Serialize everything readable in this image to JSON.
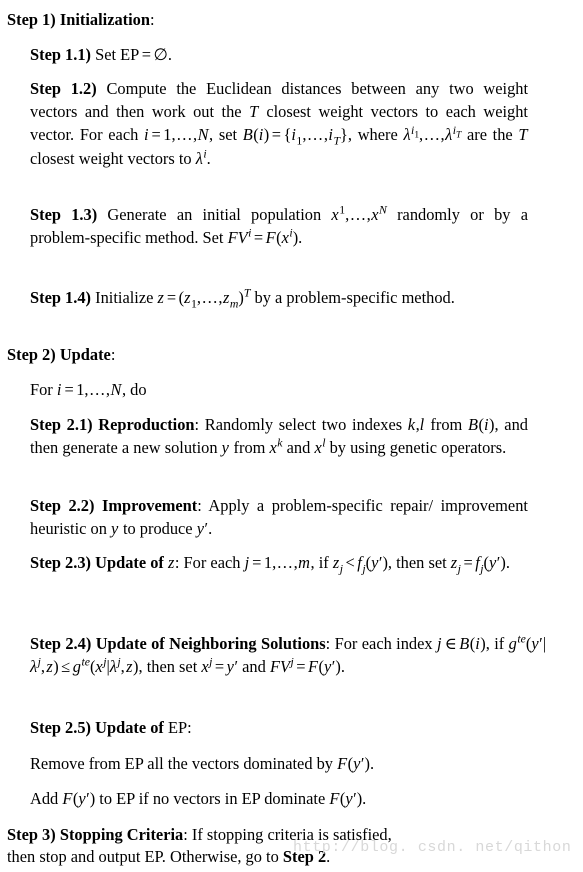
{
  "document": {
    "type": "algorithm-pseudocode",
    "title_implied": "MOEA/D Algorithm Steps",
    "watermark": "http://blog. csdn. net/qithon",
    "watermark_color": "#d8d8d8",
    "text_color": "#000000",
    "background_color": "#ffffff"
  },
  "steps": {
    "step1": {
      "label": "Step 1)",
      "heading": "Initialization",
      "colon": ":"
    },
    "step1_1": {
      "label": "Step 1.1)",
      "text_parts": {
        "a": "Set EP",
        "eq": "=",
        "empty_set": "∅",
        "period": "."
      },
      "plain": "Step 1.1) Set EP = ∅."
    },
    "step1_2": {
      "label": "Step 1.2)",
      "plain": "Step 1.2) Compute the Euclidean distances between any two weight vectors and then work out the T closest weight vectors to each weight vector. For each i = 1,…,N, set B(i) = {i₁,…,i_T}, where λ^{i₁},…,λ^{i_T} are the T closest weight vectors to λ^i.",
      "frag": {
        "f1": "Compute",
        "f2": "the",
        "f3": "Euclidean",
        "f4": "distances",
        "f5": "between",
        "f6": "any",
        "f7": "two weight vectors and then work out the",
        "f8": "closest weight",
        "f9": "vectors to each weight vector. For each",
        "f10": "set",
        "f11": "where",
        "f12": "are the",
        "f13": "closest",
        "f14": "weight vectors to"
      }
    },
    "step1_3": {
      "label": "Step 1.3)",
      "plain": "Step 1.3) Generate an initial population x¹,…,x^N randomly or by a problem-specific method. Set FVⁱ = F(xⁱ).",
      "frag": {
        "f1": "Generate",
        "f2": "an",
        "f3": "initial",
        "f4": "population",
        "f5": "randomly",
        "f6": "or",
        "f7": "by",
        "f8": "a",
        "f9": "problem-specific",
        "f10": "method.",
        "f11": "Set"
      }
    },
    "step1_4": {
      "label": "Step 1.4)",
      "plain": "Step 1.4) Initialize z = (z₁,…,z_m)^T by a problem-specific method.",
      "frag": {
        "f1": "Initialize",
        "f2": "by a problem-specific",
        "f3": "method."
      }
    },
    "step2": {
      "label": "Step 2)",
      "heading": "Update",
      "colon": ":"
    },
    "step2_for": {
      "plain": "For i = 1,…,N, do",
      "frag": {
        "f1": "For",
        "f2": "do"
      }
    },
    "step2_1": {
      "label": "Step 2.1)",
      "heading": "Reproduction",
      "plain": "Step 2.1) Reproduction: Randomly select two indexes k,l from B(i), and then generate a new solution y from x^k and x^l by using genetic operators.",
      "frag": {
        "f1": "Randomly select two indexes",
        "f2": "from",
        "f3": "and then generate a new solution",
        "f4": "from",
        "f5": "and",
        "f6": "by using genetic operators."
      }
    },
    "step2_2": {
      "label": "Step 2.2)",
      "heading": "Improvement",
      "plain": "Step 2.2) Improvement: Apply a problem-specific repair/ improvement heuristic on y to produce y′.",
      "frag": {
        "f1": "Apply",
        "f2": "a",
        "f3": "problem-specific",
        "f4": "repair/",
        "f5": "improvement heuristic on",
        "f6": "to produce"
      }
    },
    "step2_3": {
      "label": "Step 2.3)",
      "heading": "Update of",
      "plain": "Step 2.3) Update of z: For each j = 1,…,m, if z_j < f_j(y′), then set z_j = f_j(y′).",
      "frag": {
        "f1": "For",
        "f2": "each",
        "f3": "if",
        "f4": "then set"
      }
    },
    "step2_4": {
      "label": "Step 2.4)",
      "heading": "Update of Neighboring Solutions",
      "plain": "Step 2.4) Update of Neighboring Solutions: For each index j ∈ B(i), if g^{te}(y′|λ^j,z) ≤ g^{te}(x^j|λ^j,z), then set x^j = y′ and FV^j = F(y′).",
      "frag": {
        "f1": "For each index",
        "f2": "if",
        "f3": "then set",
        "f4": "and"
      }
    },
    "step2_5": {
      "label": "Step 2.5)",
      "heading": "Update of",
      "heading_tail": "EP",
      "colon": ":",
      "line_remove": "Remove from EP all the vectors dominated by F(y′).",
      "line_add": "Add F(y′) to EP if no vectors in EP dominate F(y′).",
      "frag": {
        "remove_a": "Remove from EP all the vectors dominated by",
        "add_a": "Add",
        "add_b": "to EP if no vectors in EP dominate"
      }
    },
    "step3": {
      "label": "Step 3)",
      "heading": "Stopping Criteria",
      "plain": "Step 3) Stopping Criteria: If stopping criteria is satisfied, then stop and output EP. Otherwise, go to Step 2.",
      "frag": {
        "f1": ": If stopping criteria is satisfied,",
        "f2": "then stop and output EP. Otherwise, go to",
        "f3": "Step 2",
        "f4": "."
      }
    }
  },
  "symbols": {
    "lambda": "λ",
    "emptyset": "∅",
    "elem": "∈",
    "leq": "≤",
    "lt": "<",
    "eq": "=",
    "prime": "′",
    "ellipsis": ",…,"
  }
}
